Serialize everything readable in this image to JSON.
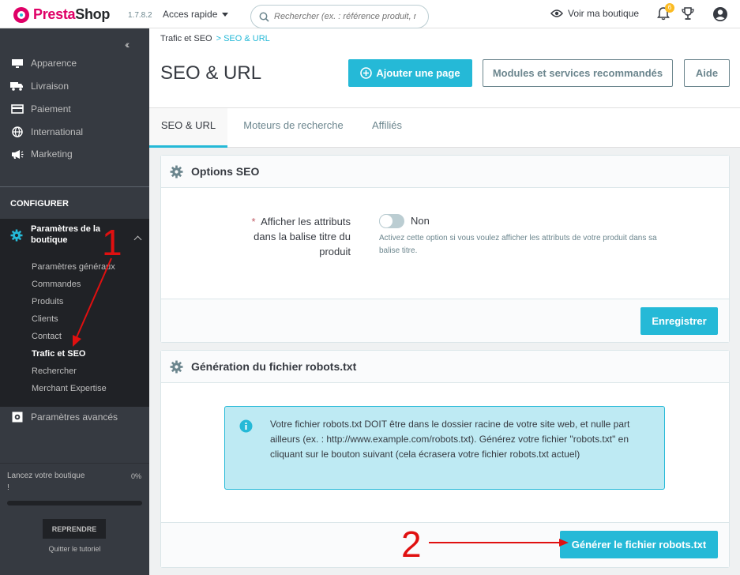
{
  "topbar": {
    "logo_brand_a": "Presta",
    "logo_brand_b": "Shop",
    "version": "1.7.8.2",
    "quick_access": "Acces rapide",
    "search_placeholder": "Rechercher (ex. : référence produit, no",
    "view_shop": "Voir ma boutique",
    "notifications_count": "6"
  },
  "sidebar": {
    "items": [
      {
        "label": "Apparence",
        "icon": "monitor-icon"
      },
      {
        "label": "Livraison",
        "icon": "truck-icon"
      },
      {
        "label": "Paiement",
        "icon": "credit-card-icon"
      },
      {
        "label": "International",
        "icon": "globe-icon"
      },
      {
        "label": "Marketing",
        "icon": "megaphone-icon"
      }
    ],
    "section_title": "CONFIGURER",
    "active_parent": "Paramètres de la boutique",
    "sub_items": [
      {
        "label": "Paramètres généraux",
        "active": false
      },
      {
        "label": "Commandes",
        "active": false
      },
      {
        "label": "Produits",
        "active": false
      },
      {
        "label": "Clients",
        "active": false
      },
      {
        "label": "Contact",
        "active": false
      },
      {
        "label": "Trafic et SEO",
        "active": true
      },
      {
        "label": "Rechercher",
        "active": false
      },
      {
        "label": "Merchant Expertise",
        "active": false
      }
    ],
    "advanced": "Paramètres avancés",
    "tour": {
      "text": "Lancez votre boutique !",
      "percent": "0%",
      "progress": 0,
      "resume_button": "REPRENDRE",
      "quit_link": "Quitter le tutoriel"
    }
  },
  "header": {
    "breadcrumb_parent": "Trafic et SEO",
    "breadcrumb_current": "> SEO & URL",
    "title": "SEO & URL",
    "add_page_button": "Ajouter une page",
    "modules_button": "Modules et services recommandés",
    "help_button": "Aide"
  },
  "tabs": [
    {
      "label": "SEO & URL",
      "active": true
    },
    {
      "label": "Moteurs de recherche",
      "active": false
    },
    {
      "label": "Affiliés",
      "active": false
    }
  ],
  "seo_options": {
    "title": "Options SEO",
    "field_label": "Afficher les attributs dans la balise titre du produit",
    "required_star": "*",
    "toggle_value": "Non",
    "help_text": "Activez cette option si vous voulez afficher les attributs de votre produit dans sa balise titre.",
    "save_button": "Enregistrer"
  },
  "robots": {
    "title": "Génération du fichier robots.txt",
    "alert_text": "Votre fichier robots.txt DOIT être dans le dossier racine de votre site web, et nulle part ailleurs (ex. : http://www.example.com/robots.txt). Générez votre fichier \"robots.txt\" en cliquant sur le bouton suivant (cela écrasera votre fichier robots.txt actuel)",
    "generate_button": "Générer le fichier robots.txt"
  },
  "annotations": {
    "step1": "1",
    "step2": "2"
  },
  "colors": {
    "primary": "#25b9d7",
    "sidebar": "#363a41",
    "sidebar_active": "#202226",
    "brand_pink": "#df0067",
    "annotation_red": "#e01010"
  }
}
